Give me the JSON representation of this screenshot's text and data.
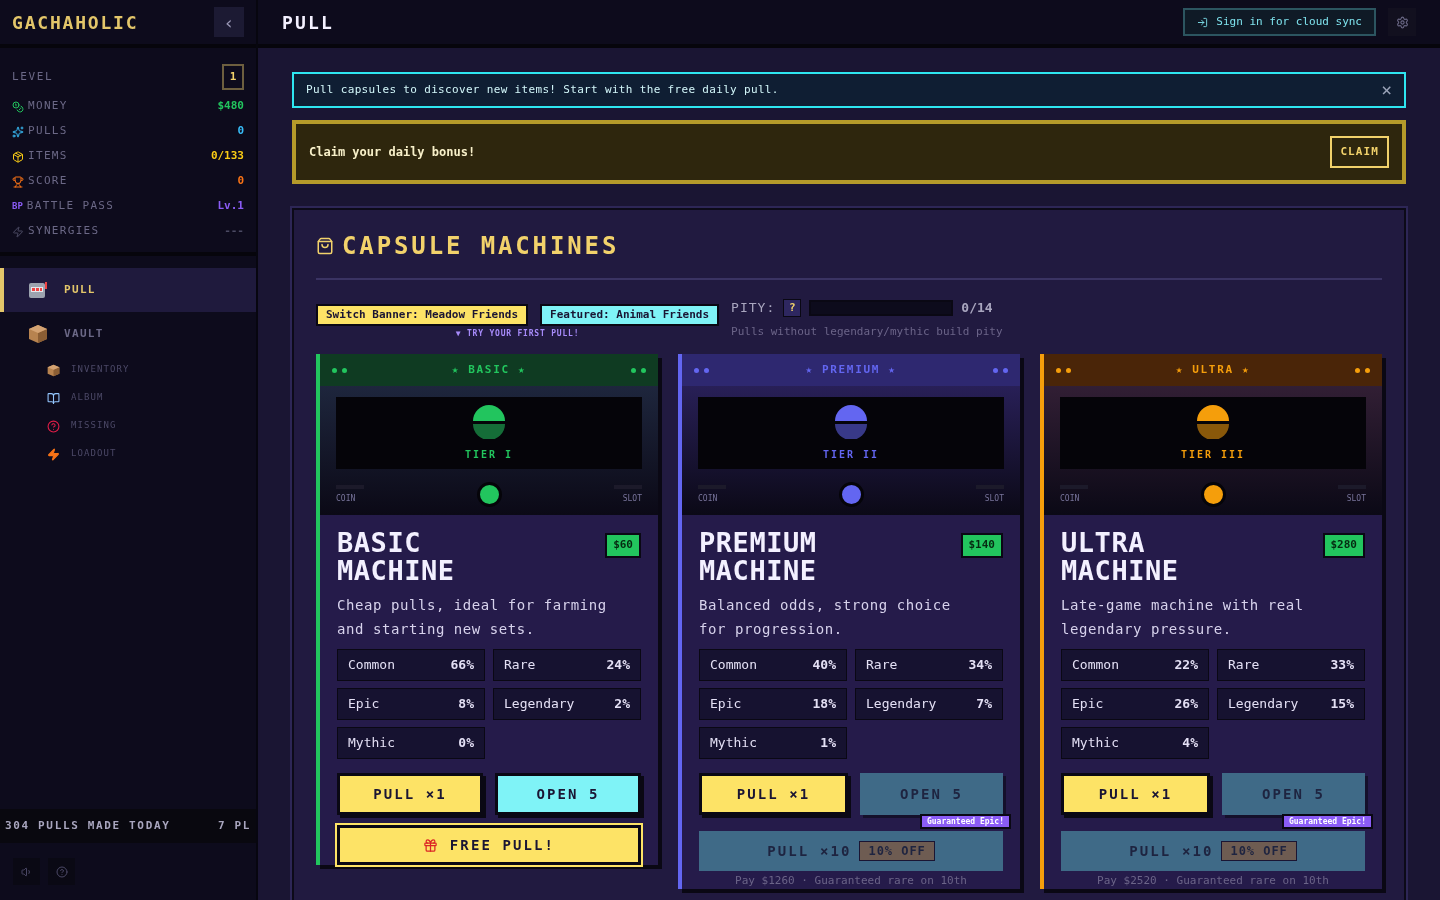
{
  "sidebar": {
    "logo": "GACHAHOLIC",
    "collapse": "‹",
    "level": {
      "label": "LEVEL",
      "value": "1"
    },
    "stats": [
      {
        "kind": "money",
        "label": "MONEY",
        "value": "$480",
        "color": "#22c55e"
      },
      {
        "kind": "pulls",
        "label": "PULLS",
        "value": "0",
        "color": "#38bdf8"
      },
      {
        "kind": "items",
        "label": "ITEMS",
        "value": "0/133",
        "color": "#facc15"
      },
      {
        "kind": "score",
        "label": "SCORE",
        "value": "0",
        "color": "#f97316"
      },
      {
        "kind": "battlepass",
        "icon_text": "BP",
        "label": "BATTLE PASS",
        "value": "Lv.1",
        "color": "#8b5cf6"
      },
      {
        "kind": "synergies",
        "label": "SYNERGIES",
        "value": "---",
        "color": "#4b4a63"
      }
    ],
    "nav": [
      {
        "kind": "slot",
        "label": "PULL",
        "selected": true
      },
      {
        "kind": "box",
        "label": "VAULT",
        "selected": false,
        "children": [
          {
            "kind": "box",
            "label": "INVENTORY",
            "selected": false
          },
          {
            "kind": "book",
            "label": "ALBUM",
            "selected": false
          },
          {
            "kind": "question",
            "label": "MISSING",
            "selected": false
          },
          {
            "kind": "bolt",
            "label": "LOADOUT",
            "selected": false
          }
        ]
      }
    ],
    "ticker": [
      "304 PULLS MADE TODAY",
      "7 PL"
    ]
  },
  "header": {
    "title": "PULL",
    "sign_in": "Sign in for cloud sync"
  },
  "info_banner": {
    "text": "Pull capsules to discover new items! Start with the free daily pull.",
    "close": "×"
  },
  "bonus_banner": {
    "text": "Claim your daily bonus!",
    "button": "CLAIM"
  },
  "machines_panel": {
    "title": "CAPSULE MACHINES",
    "switch_banner": "Switch Banner: Meadow Friends",
    "featured": "Featured: Animal Friends",
    "hint": "▼ TRY YOUR FIRST PULL!",
    "pity": {
      "label": "PITY:",
      "help": "?",
      "level": 0,
      "count": "0/14",
      "note": "Pulls without legendary/mythic build pity"
    },
    "machines": [
      {
        "header": "★ BASIC ★",
        "tier": "TIER I",
        "color": "#22c55e",
        "coin": "COIN",
        "slot": "SLOT",
        "title": "BASIC MACHINE",
        "price": "$60",
        "description": "Cheap pulls, ideal for farming and starting new sets.",
        "odds": [
          {
            "name": "Common",
            "pct": "66%"
          },
          {
            "name": "Rare",
            "pct": "24%"
          },
          {
            "name": "Epic",
            "pct": "8%"
          },
          {
            "name": "Legendary",
            "pct": "2%"
          },
          {
            "name": "Mythic",
            "pct": "0%"
          }
        ],
        "pull_one": {
          "label": "PULL ×1",
          "disabled": false
        },
        "open_five": {
          "label": "OPEN 5",
          "disabled": false
        },
        "free_pull": {
          "label": "FREE PULL!"
        }
      },
      {
        "header": "★ PREMIUM ★",
        "tier": "TIER II",
        "color": "#6366f1",
        "coin": "COIN",
        "slot": "SLOT",
        "title": "PREMIUM MACHINE",
        "price": "$140",
        "description": "Balanced odds, strong choice for progression.",
        "odds": [
          {
            "name": "Common",
            "pct": "40%"
          },
          {
            "name": "Rare",
            "pct": "34%"
          },
          {
            "name": "Epic",
            "pct": "18%"
          },
          {
            "name": "Legendary",
            "pct": "7%"
          },
          {
            "name": "Mythic",
            "pct": "1%"
          }
        ],
        "pull_one": {
          "label": "PULL ×1",
          "disabled": false
        },
        "open_five": {
          "label": "OPEN 5",
          "disabled": true
        },
        "pull_ten": {
          "label": "PULL ×10",
          "discount": "10% OFF",
          "badge": "Guaranteed Epic!",
          "disabled": true
        },
        "note": "Pay $1260 · Guaranteed rare on 10th"
      },
      {
        "header": "★ ULTRA ★",
        "tier": "TIER III",
        "color": "#f59e0b",
        "coin": "COIN",
        "slot": "SLOT",
        "title": "ULTRA MACHINE",
        "price": "$280",
        "description": "Late-game machine with real legendary pressure.",
        "odds": [
          {
            "name": "Common",
            "pct": "22%"
          },
          {
            "name": "Rare",
            "pct": "33%"
          },
          {
            "name": "Epic",
            "pct": "26%"
          },
          {
            "name": "Legendary",
            "pct": "15%"
          },
          {
            "name": "Mythic",
            "pct": "4%"
          }
        ],
        "pull_one": {
          "label": "PULL ×1",
          "disabled": false
        },
        "open_five": {
          "label": "OPEN 5",
          "disabled": true
        },
        "pull_ten": {
          "label": "PULL ×10",
          "discount": "10% OFF",
          "badge": "Guaranteed Epic!",
          "disabled": true
        },
        "note": "Pay $2520 · Guaranteed rare on 10th"
      }
    ]
  }
}
